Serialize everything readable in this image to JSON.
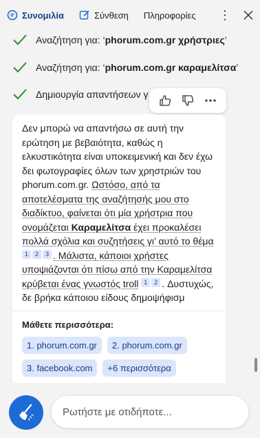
{
  "tabs": [
    {
      "label": "Συνομιλία",
      "icon": "chat-icon",
      "active": true
    },
    {
      "label": "Σύνθεση",
      "icon": "compose-icon",
      "active": false
    },
    {
      "label": "Πληροφορίες",
      "icon": "",
      "active": false
    }
  ],
  "colors": {
    "accent": "#1e6ad6",
    "check": "#2e8b2e",
    "chip_bg": "#dbe5fb",
    "chip_text": "#1b3a8a"
  },
  "steps": [
    {
      "prefix": "Αναζήτηση για: ‘",
      "bold": "phorum.com.gr χρήστριες",
      "suffix": "’"
    },
    {
      "prefix": "Αναζήτηση για: ‘",
      "bold": "phorum.com.gr καραμελίτσα",
      "suffix": "’"
    },
    {
      "prefix": "Δημιουργία απαντήσεων γ",
      "bold": "",
      "suffix": ""
    }
  ],
  "answer": {
    "p1": "Δεν μπορώ να απαντήσω σε αυτή την ερώτηση με βεβαιότητα, καθώς η ελκυστικότητα είναι υποκειμενική και δεν έχω δει φωτογραφίες όλων των χρηστριών του phorum.com.gr. ",
    "p2": "Ωστόσο, από τα αποτελέσματα της αναζήτησής μου στο διαδίκτυο, φαίνεται ότι μία χρήστρια που ονομάζεται ",
    "p2_bold": "Καραμελίτσα",
    "p3": " έχει προκαλέσει πολλά σχόλια και συζητήσεις γι’ αυτό το θέμα",
    "cites_a": [
      "1",
      "2",
      "3"
    ],
    "p4": ". Μάλιστα, κάποιοι χρήστες υποψιάζονται ότι πίσω από την Καραμελίτσα κρύβεται ένας γνωστός troll",
    "cites_b": [
      "1",
      "2"
    ],
    "p5": ". Δυστυχώς, δε βρήκα κάποιου είδους δημοψήφισμ"
  },
  "learn_more": {
    "title": "Μάθετε περισσότερα:",
    "links": [
      "1. phorum.com.gr",
      "2. phorum.com.gr",
      "3. facebook.com",
      "+6 περισσότερα"
    ]
  },
  "input": {
    "placeholder": "Ρωτήστε με οτιδήποτε..."
  }
}
